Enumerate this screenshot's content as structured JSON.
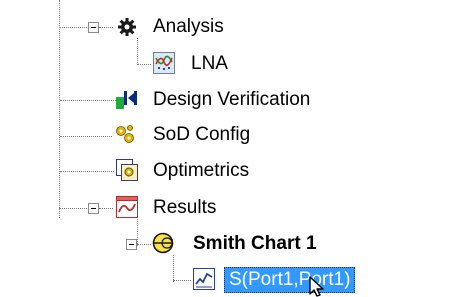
{
  "tree": {
    "analysis": {
      "label": "Analysis",
      "icon": "gear-icon"
    },
    "lna": {
      "label": "LNA",
      "icon": "lna-setup-icon"
    },
    "design_verification": {
      "label": "Design Verification",
      "icon": "design-verification-icon"
    },
    "sod_config": {
      "label": "SoD Config",
      "icon": "gears-icon"
    },
    "optimetrics": {
      "label": "Optimetrics",
      "icon": "optimetrics-icon"
    },
    "results": {
      "label": "Results",
      "icon": "results-icon"
    },
    "smith_chart": {
      "label": "Smith Chart 1",
      "icon": "smith-chart-icon"
    },
    "s_param": {
      "label": "S(Port1,Port1)",
      "icon": "trace-icon",
      "selected": true
    }
  },
  "colors": {
    "selection": "#3399ff",
    "tree_line": "#808080"
  }
}
